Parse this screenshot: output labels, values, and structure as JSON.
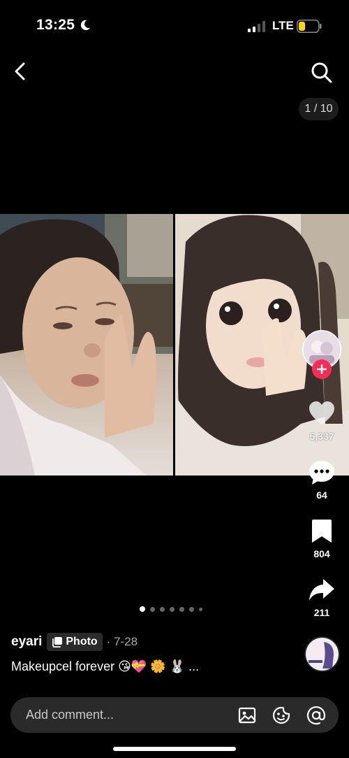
{
  "status_bar": {
    "time": "13:25",
    "network": "LTE",
    "battery_level": 0.35,
    "battery_color": "#ffd60a"
  },
  "nav": {
    "back_icon": "chevron-left-icon",
    "search_icon": "search-icon",
    "page_counter": "1 / 10"
  },
  "post": {
    "current_slide": 1,
    "total_slides": 10,
    "username": "eyari",
    "badge_label": "Photo",
    "date": "· 7-28",
    "caption": "Makeupcel forever 😘💝 🌼 🐰 ..."
  },
  "actions": {
    "like_count": "5,337",
    "comment_count": "64",
    "save_count": "804",
    "share_count": "211"
  },
  "comment_bar": {
    "placeholder": "Add comment...",
    "icons": [
      "image-icon",
      "emoji-sticker-icon",
      "mention-at-icon"
    ]
  },
  "colors": {
    "accent": "#fe2c55",
    "background": "#000000",
    "pill": "#2a2a2a"
  }
}
